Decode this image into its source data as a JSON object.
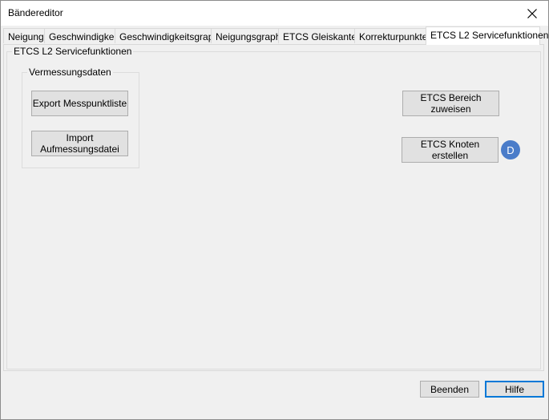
{
  "window": {
    "title": "Bändereditor",
    "close_icon": "close-icon"
  },
  "tabs": [
    {
      "label": "Neigung"
    },
    {
      "label": "Geschwindigkeit"
    },
    {
      "label": "Geschwindigkeitsgraph"
    },
    {
      "label": "Neigungsgraph"
    },
    {
      "label": "ETCS Gleiskanten"
    },
    {
      "label": "Korrekturpunkte"
    },
    {
      "label": "ETCS L2 Servicefunktionen",
      "active": true
    }
  ],
  "panel": {
    "group_title": "ETCS L2 Servicefunktionen",
    "vermessung": {
      "title": "Vermessungsdaten",
      "export_button": "Export Messpunktliste",
      "import_button_line1": "Import",
      "import_button_line2": "Aufmessungsdatei"
    },
    "bereich_button": "ETCS Bereich zuweisen",
    "knoten_button": "ETCS Knoten erstellen",
    "badge_letter": "D",
    "badge_color": "#4a7cc9"
  },
  "footer": {
    "beenden_button": "Beenden",
    "hilfe_button": "Hilfe"
  }
}
